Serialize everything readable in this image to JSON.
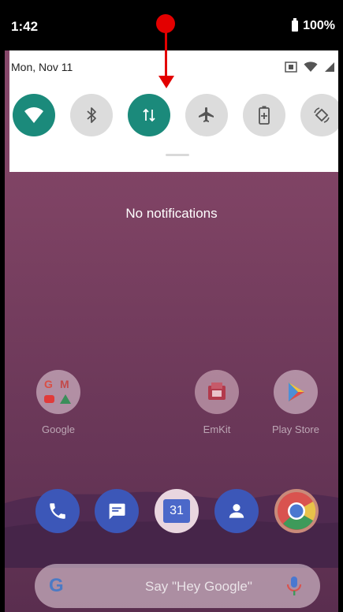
{
  "status": {
    "time": "1:42",
    "battery": "100%"
  },
  "quick_settings": {
    "date": "Mon, Nov 11",
    "tiles": [
      {
        "icon": "wifi-icon",
        "state": "on"
      },
      {
        "icon": "bluetooth-icon",
        "state": "off"
      },
      {
        "icon": "mobile-data-icon",
        "state": "on"
      },
      {
        "icon": "airplane-mode-icon",
        "state": "off"
      },
      {
        "icon": "battery-saver-icon",
        "state": "off"
      },
      {
        "icon": "auto-rotate-icon",
        "state": "off"
      }
    ]
  },
  "home": {
    "no_notifications": "No notifications",
    "apps": [
      {
        "label": "Google",
        "icon": "google-folder-icon"
      },
      {
        "label": "EmKit",
        "icon": "emkit-icon"
      },
      {
        "label": "Play Store",
        "icon": "play-store-icon"
      }
    ],
    "dock": [
      {
        "icon": "phone-icon"
      },
      {
        "icon": "messages-icon"
      },
      {
        "icon": "calendar-icon",
        "text": "31"
      },
      {
        "icon": "contacts-icon"
      },
      {
        "icon": "chrome-icon"
      }
    ],
    "search": {
      "logo": "G",
      "hint": "Say \"Hey Google\""
    }
  },
  "colors": {
    "tile_on": "#1b8a7b",
    "tile_off": "#dcdcdc",
    "annotation_arrow": "#e30000"
  }
}
